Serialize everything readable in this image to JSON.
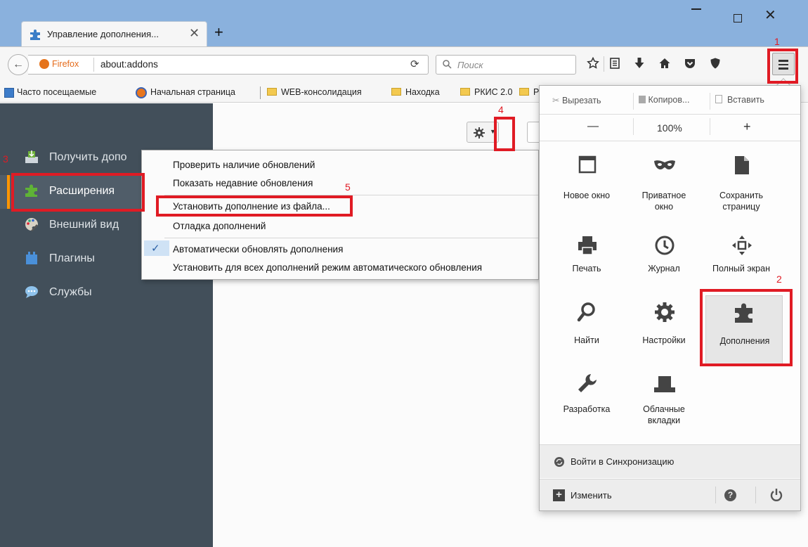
{
  "tab": {
    "title": "Управление дополнения...",
    "close": "✕",
    "new": "+"
  },
  "window": {
    "minimize": "—",
    "close": "✕"
  },
  "navbar": {
    "identity": "Firefox",
    "url": "about:addons",
    "search_placeholder": "Поиск",
    "reload": "⟳"
  },
  "bookmarks": [
    {
      "label": "Часто посещаемые"
    },
    {
      "label": "Начальная страница"
    },
    {
      "label": "WEB-консолидация"
    },
    {
      "label": "Находка"
    },
    {
      "label": "РКИС 2.0"
    },
    {
      "label": "Р"
    }
  ],
  "sidebar": {
    "items": [
      {
        "label": "Получить допо"
      },
      {
        "label": "Расширения"
      },
      {
        "label": "Внешний вид"
      },
      {
        "label": "Плагины"
      },
      {
        "label": "Службы"
      }
    ]
  },
  "context_menu": {
    "items": [
      {
        "label": "Проверить наличие обновлений"
      },
      {
        "label": "Показать недавние обновления"
      },
      {
        "label": "Установить дополнение из файла..."
      },
      {
        "label": "Отладка дополнений"
      },
      {
        "label": "Автоматически обновлять дополнения",
        "checked": true
      },
      {
        "label": "Установить для всех дополнений режим автоматического обновления"
      }
    ]
  },
  "panel": {
    "cut": "Вырезать",
    "copy": "Копиров...",
    "paste": "Вставить",
    "zoom_out": "—",
    "zoom": "100%",
    "zoom_in": "+",
    "tiles": [
      {
        "label": "Новое окно",
        "icon": "new-window-icon"
      },
      {
        "label": "Приватное окно",
        "icon": "private-mask-icon"
      },
      {
        "label": "Сохранить страницу",
        "icon": "save-page-icon"
      },
      {
        "label": "Печать",
        "icon": "print-icon"
      },
      {
        "label": "Журнал",
        "icon": "history-clock-icon"
      },
      {
        "label": "Полный экран",
        "icon": "fullscreen-icon"
      },
      {
        "label": "Найти",
        "icon": "find-icon"
      },
      {
        "label": "Настройки",
        "icon": "settings-gear-icon"
      },
      {
        "label": "Дополнения",
        "icon": "addons-puzzle-icon"
      },
      {
        "label": "Разработка",
        "icon": "developer-wrench-icon"
      },
      {
        "label": "Облачные вкладки",
        "icon": "synced-tabs-icon"
      }
    ],
    "sync": "Войти в Синхронизацию",
    "customize": "Изменить",
    "customize_icon": "+"
  },
  "annotations": [
    "1",
    "2",
    "3",
    "4",
    "5"
  ],
  "colors": {
    "sidebar": "#424f5a",
    "accent": "#ff9500",
    "annotation": "#e01b24",
    "titlebar": "#8ab1dd"
  }
}
